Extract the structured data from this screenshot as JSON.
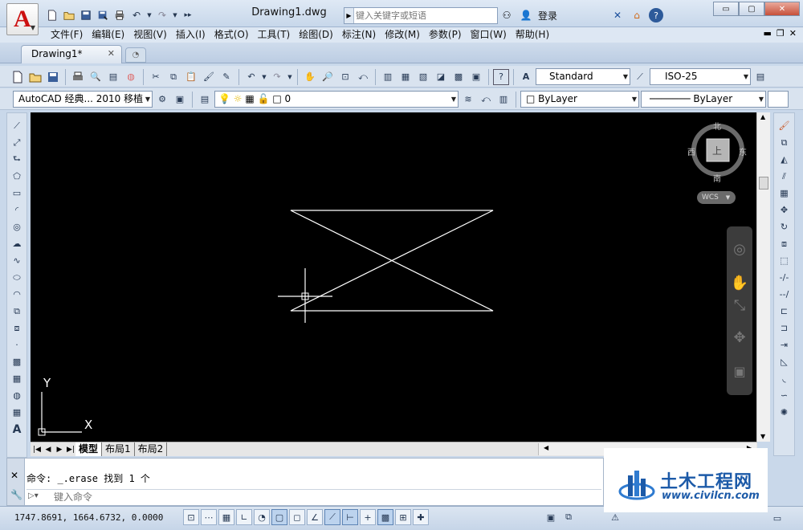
{
  "title_bar": {
    "document_title": "Drawing1.dwg",
    "search_placeholder": "键入关键字或短语",
    "login_label": "登录",
    "minimize": "▭",
    "restore": "▢",
    "close": "✕"
  },
  "menu": {
    "items": [
      "文件(F)",
      "编辑(E)",
      "视图(V)",
      "插入(I)",
      "格式(O)",
      "工具(T)",
      "绘图(D)",
      "标注(N)",
      "修改(M)",
      "参数(P)",
      "窗口(W)",
      "帮助(H)"
    ]
  },
  "tabs": {
    "document_tab": "Drawing1*",
    "close_glyph": "✕"
  },
  "toolbar": {
    "text_style": "Standard",
    "dim_style": "ISO-25",
    "workspace": "AutoCAD 经典... 2010 移植",
    "layer": "0",
    "color": "ByLayer",
    "linetype": "ByLayer"
  },
  "viewcube": {
    "north": "北",
    "south": "南",
    "east": "东",
    "west": "西",
    "face": "上",
    "wcs": "WCS"
  },
  "ucs": {
    "x_label": "X",
    "y_label": "Y"
  },
  "layout_tabs": [
    "模型",
    "布局1",
    "布局2"
  ],
  "command": {
    "history": "命令: _.erase 找到 1 个",
    "input_placeholder": "键入命令"
  },
  "status": {
    "coordinates": "1747.8691, 1664.6732, 0.0000"
  },
  "watermark": {
    "title": "土木工程网",
    "url": "www.civilcn.com"
  },
  "colors": {
    "canvas": "#000000",
    "geometry": "#ffffff",
    "logo_red": "#cc1111",
    "watermark_blue": "#1c5aa8"
  }
}
